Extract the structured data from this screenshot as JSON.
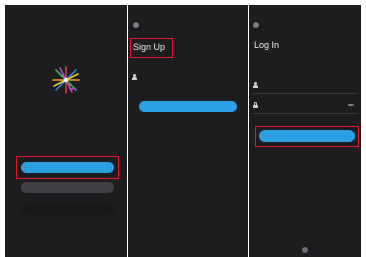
{
  "screens": [
    {
      "status": {
        "carrier": "",
        "battery": ""
      },
      "logo_name": "colorful-starburst-logo",
      "buttons": {
        "sign_up": "",
        "log_in": "",
        "no_account": ""
      }
    },
    {
      "status": {
        "carrier": "",
        "battery": ""
      },
      "title": "Sign Up",
      "username_placeholder": "",
      "continue_button": ""
    },
    {
      "status": {
        "carrier": "",
        "battery": ""
      },
      "title": "Log In",
      "subtitle": "",
      "username_placeholder": "",
      "password_placeholder": "",
      "login_button": "",
      "forgot_password": ""
    }
  ],
  "colors": {
    "background": "#1d1d20",
    "accent_blue": "#2aa0e2",
    "highlight_red": "#e0162b"
  }
}
